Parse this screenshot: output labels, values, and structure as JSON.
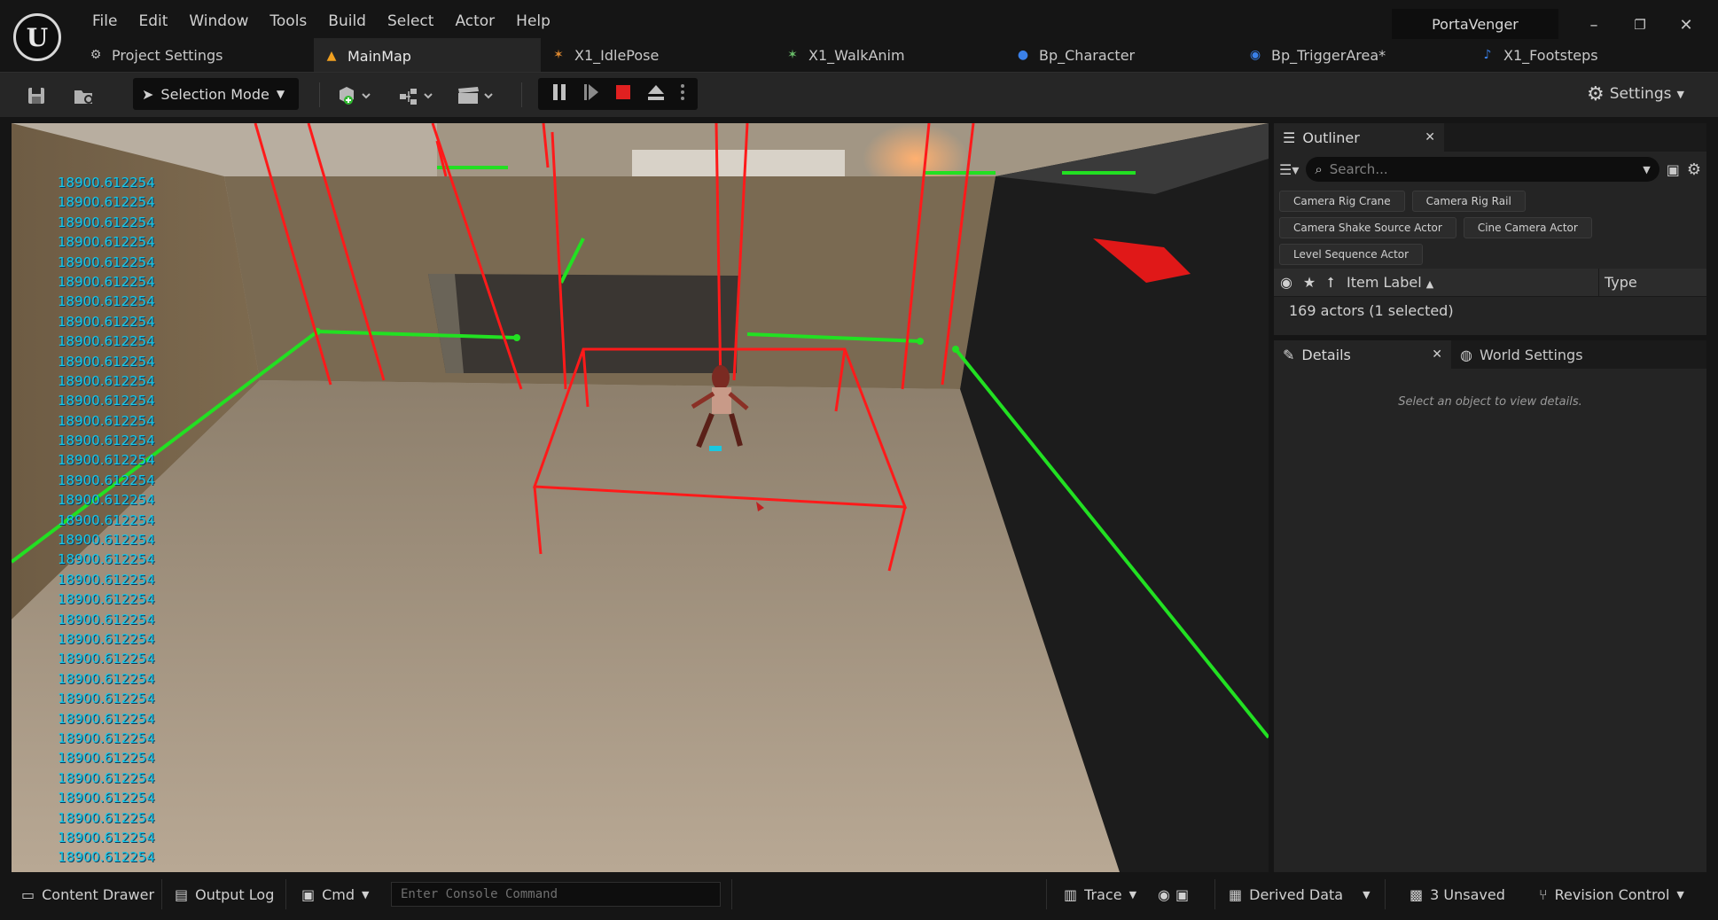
{
  "app": {
    "project_name": "PortaVenger",
    "logo_glyph": "U"
  },
  "menu": [
    "File",
    "Edit",
    "Window",
    "Tools",
    "Build",
    "Select",
    "Actor",
    "Help"
  ],
  "window_controls": {
    "minimize": "–",
    "restore": "❐",
    "close": "✕"
  },
  "tabs": [
    {
      "label": "Project Settings",
      "icon": "gear-icon",
      "active": false
    },
    {
      "label": "MainMap",
      "icon": "level-icon",
      "active": true
    },
    {
      "label": "X1_IdlePose",
      "icon": "pose-icon",
      "active": false
    },
    {
      "label": "X1_WalkAnim",
      "icon": "animation-icon",
      "active": false
    },
    {
      "label": "Bp_Character",
      "icon": "character-icon",
      "active": false
    },
    {
      "label": "Bp_TriggerArea*",
      "icon": "blueprint-icon",
      "active": false
    },
    {
      "label": "X1_Footsteps",
      "icon": "sound-icon",
      "active": false
    }
  ],
  "toolbar": {
    "mode_label": "Selection Mode",
    "settings_label": "Settings"
  },
  "viewport": {
    "debug_value": "18900.612254",
    "debug_count": 35
  },
  "outliner": {
    "tab_label": "Outliner",
    "search_placeholder": "Search...",
    "filters": [
      "Camera Rig Crane",
      "Camera Rig Rail",
      "Camera Shake Source Actor",
      "Cine Camera Actor",
      "Level Sequence Actor"
    ],
    "col_label": "Item Label",
    "col_type": "Type",
    "summary": "169 actors (1 selected)"
  },
  "details": {
    "tab_label": "Details",
    "world_tab_label": "World Settings",
    "empty_text": "Select an object to view details."
  },
  "statusbar": {
    "content_drawer": "Content Drawer",
    "output_log": "Output Log",
    "cmd": "Cmd",
    "console_placeholder": "Enter Console Command",
    "trace": "Trace",
    "derived_data": "Derived Data",
    "unsaved": "3 Unsaved",
    "revision_control": "Revision Control"
  },
  "colors": {
    "accent": "#f0a020",
    "debug_text": "#19c8e8",
    "trigger_red": "#ff1a1a",
    "nav_green": "#22e022",
    "stop_red": "#e02020"
  }
}
